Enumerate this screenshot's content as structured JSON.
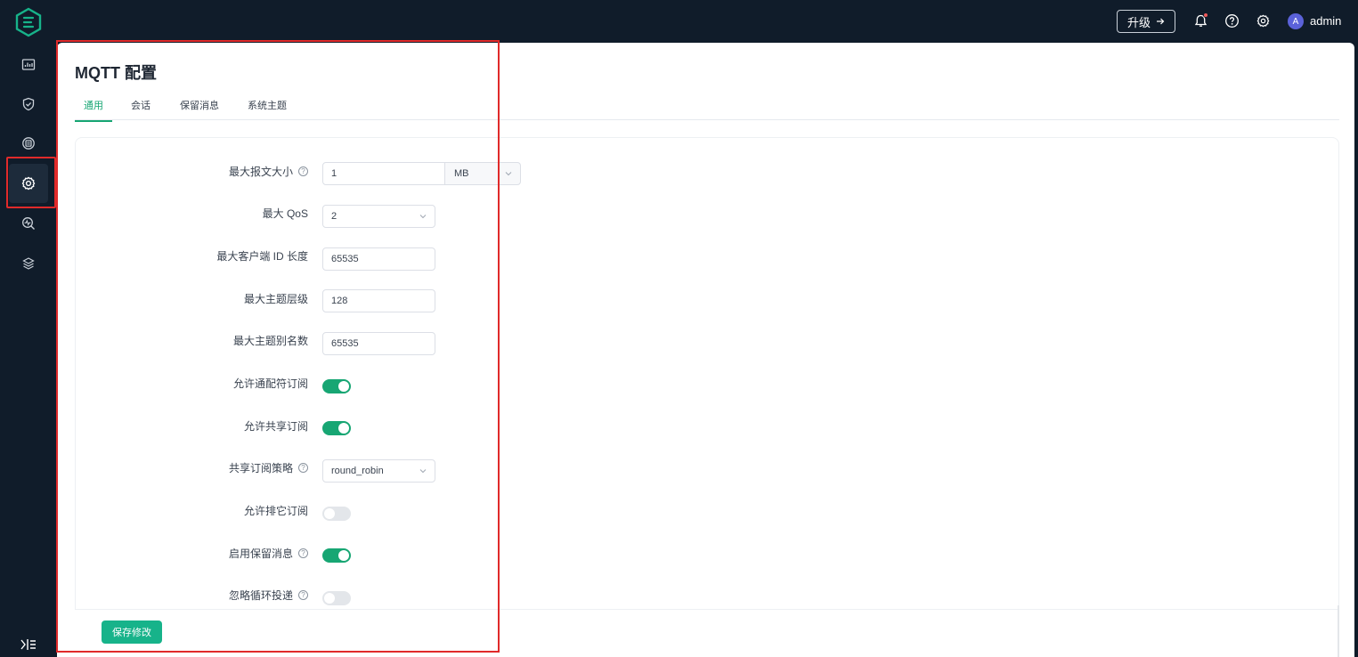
{
  "header": {
    "upgrade_label": "升级",
    "user_initial": "A",
    "user_name": "admin"
  },
  "sidebar": {
    "items": [
      {
        "icon": "dashboard-icon"
      },
      {
        "icon": "shield-icon"
      },
      {
        "icon": "data-integration-icon"
      },
      {
        "icon": "settings-icon",
        "active": true
      },
      {
        "icon": "diagnose-icon"
      },
      {
        "icon": "extensions-icon"
      }
    ]
  },
  "page": {
    "title": "MQTT 配置",
    "tabs": [
      "通用",
      "会话",
      "保留消息",
      "系统主题"
    ],
    "active_tab": "通用"
  },
  "form": {
    "max_packet_size": {
      "label": "最大报文大小",
      "value": "1",
      "unit": "MB"
    },
    "max_qos": {
      "label": "最大 QoS",
      "value": "2"
    },
    "max_clientid_len": {
      "label": "最大客户端 ID 长度",
      "value": "65535"
    },
    "max_topic_levels": {
      "label": "最大主题层级",
      "value": "128"
    },
    "max_topic_alias": {
      "label": "最大主题别名数",
      "value": "65535"
    },
    "wildcard_subscription": {
      "label": "允许通配符订阅",
      "enabled": true
    },
    "shared_subscription": {
      "label": "允许共享订阅",
      "enabled": true
    },
    "shared_subscription_strategy": {
      "label": "共享订阅策略",
      "value": "round_robin"
    },
    "exclusive_subscription": {
      "label": "允许排它订阅",
      "enabled": false
    },
    "retain_available": {
      "label": "启用保留消息",
      "enabled": true
    },
    "ignore_loop_deliver": {
      "label": "忽略循环投递",
      "enabled": false
    }
  },
  "footer": {
    "save_label": "保存修改"
  },
  "colors": {
    "accent": "#17a673",
    "sidebar_bg": "#101c2a",
    "highlight": "#e02a2a"
  }
}
